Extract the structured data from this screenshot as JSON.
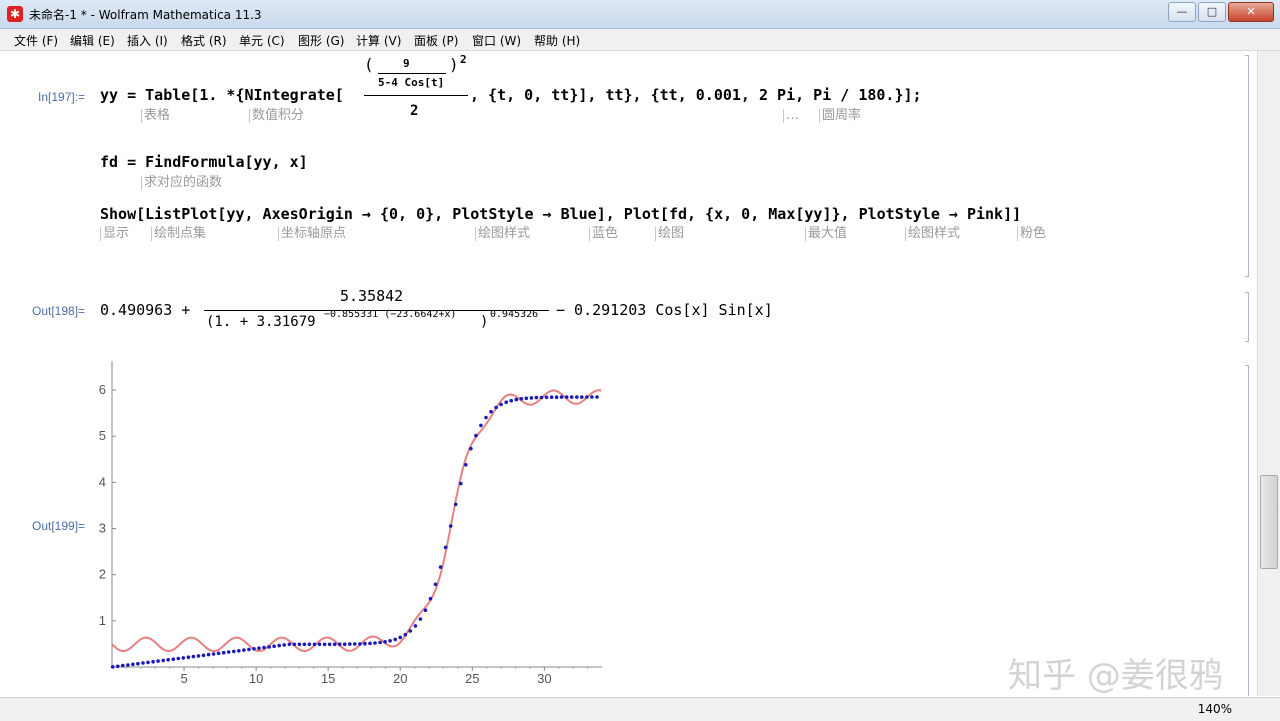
{
  "window": {
    "title": "未命名-1 * - Wolfram Mathematica 11.3",
    "buttons": [
      "—",
      "□",
      "✕"
    ]
  },
  "menubar": {
    "items": [
      "文件 (F)",
      "编辑 (E)",
      "插入 (I)",
      "格式 (R)",
      "单元 (C)",
      "图形 (G)",
      "计算 (V)",
      "面板 (P)",
      "窗口 (W)",
      "帮助 (H)"
    ]
  },
  "cells": {
    "in_label": "In[197]:=",
    "line1": {
      "prefix": "yy = Table[1. *{NIntegrate[",
      "num": "9",
      "den": "5-4 Cos[t]",
      "power": "2",
      "denom2": "2",
      "suffix": ", {t, 0, tt}], tt}, {tt, 0.001, 2 Pi, Pi / 180.}];",
      "annotations": [
        "表格",
        "数值积分",
        "…",
        "圆周率"
      ]
    },
    "line2": {
      "code": "fd = FindFormula[yy, x]",
      "annotations": [
        "求对应的函数"
      ]
    },
    "line3": {
      "code": "Show[ListPlot[yy, AxesOrigin → {0, 0}, PlotStyle → Blue], Plot[fd, {x, 0, Max[yy]}, PlotStyle → Pink]]",
      "annotations": [
        "显示",
        "绘制点集",
        "坐标轴原点",
        "绘图样式",
        "蓝色",
        "绘图",
        "最大值",
        "绘图样式",
        "粉色"
      ]
    },
    "out198_label": "Out[198]=",
    "out198": {
      "a": "0.490963 +",
      "num": "5.35842",
      "den_base": "(1. + 3.31679",
      "den_exp": "−0.855331 (−23.6642+x)",
      "den_close": ")",
      "den_pow": "0.945326",
      "tail": "− 0.291203 Cos[x] Sin[x]"
    },
    "out199_label": "Out[199]="
  },
  "chart_data": {
    "type": "line",
    "xlim": [
      0,
      34
    ],
    "ylim": [
      0,
      6.5
    ],
    "x_ticks": [
      "5",
      "10",
      "15",
      "20",
      "25",
      "30"
    ],
    "y_ticks": [
      "1",
      "2",
      "3",
      "4",
      "5",
      "6"
    ],
    "series": [
      {
        "name": "ListPlot yy",
        "color": "#1a1ab8",
        "style": "points"
      },
      {
        "name": "Plot fd",
        "color": "#e88080",
        "style": "line"
      }
    ],
    "formula": {
      "a": 0.490963,
      "b": 5.35842,
      "base": 3.31679,
      "k": -0.855331,
      "x0": 23.6642,
      "p": 0.945326,
      "c": -0.291203
    }
  },
  "status": {
    "zoom": "140%"
  },
  "watermark": "知乎 @姜很鸦"
}
